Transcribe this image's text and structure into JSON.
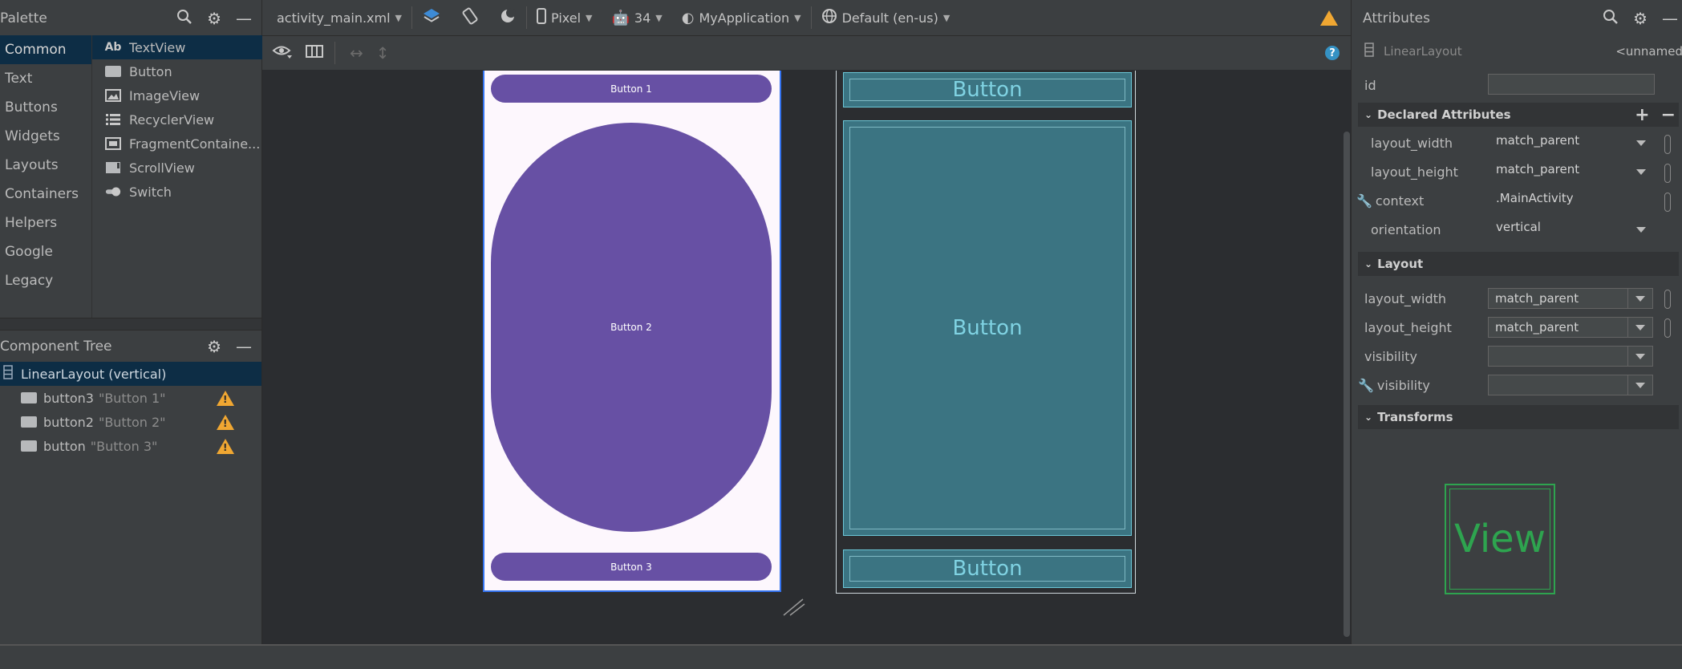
{
  "palette": {
    "title": "Palette",
    "categories": [
      "Common",
      "Text",
      "Buttons",
      "Widgets",
      "Layouts",
      "Containers",
      "Helpers",
      "Google",
      "Legacy"
    ],
    "items": [
      {
        "icon": "Ab",
        "label": "TextView"
      },
      {
        "icon": "button-icon",
        "label": "Button"
      },
      {
        "icon": "image-icon",
        "label": "ImageView"
      },
      {
        "icon": "list-icon",
        "label": "RecyclerView"
      },
      {
        "icon": "fragment-icon",
        "label": "FragmentContaine..."
      },
      {
        "icon": "scroll-icon",
        "label": "ScrollView"
      },
      {
        "icon": "switch-icon",
        "label": "Switch"
      }
    ]
  },
  "component_tree": {
    "title": "Component Tree",
    "root": "LinearLayout (vertical)",
    "children": [
      {
        "id": "button3",
        "text": "\"Button 1\""
      },
      {
        "id": "button2",
        "text": "\"Button 2\""
      },
      {
        "id": "button",
        "text": "\"Button 3\""
      }
    ]
  },
  "toolbar": {
    "file": "activity_main.xml",
    "device": "Pixel",
    "api": "34",
    "theme": "MyApplication",
    "locale": "Default (en-us)"
  },
  "design": {
    "button1": "Button 1",
    "button2": "Button 2",
    "button3": "Button 3",
    "blueprint_label": "Button"
  },
  "attributes": {
    "title": "Attributes",
    "component": "LinearLayout",
    "component_id": "<unnamed",
    "id_label": "id",
    "declared_title": "Declared Attributes",
    "declared": [
      {
        "name": "layout_width",
        "value": "match_parent"
      },
      {
        "name": "layout_height",
        "value": "match_parent"
      },
      {
        "name": "context",
        "value": ".MainActivity"
      },
      {
        "name": "orientation",
        "value": "vertical"
      }
    ],
    "layout_title": "Layout",
    "layout": [
      {
        "name": "layout_width",
        "value": "match_parent"
      },
      {
        "name": "layout_height",
        "value": "match_parent"
      },
      {
        "name": "visibility",
        "value": ""
      },
      {
        "name": "visibility",
        "value": ""
      }
    ],
    "transforms_title": "Transforms",
    "view_preview": "View"
  },
  "colors": {
    "accent": "#3574f0",
    "m3_purple": "#6750a4",
    "blueprint": "#3b7482",
    "warning": "#f0a732",
    "view_green": "#2ea44f"
  }
}
